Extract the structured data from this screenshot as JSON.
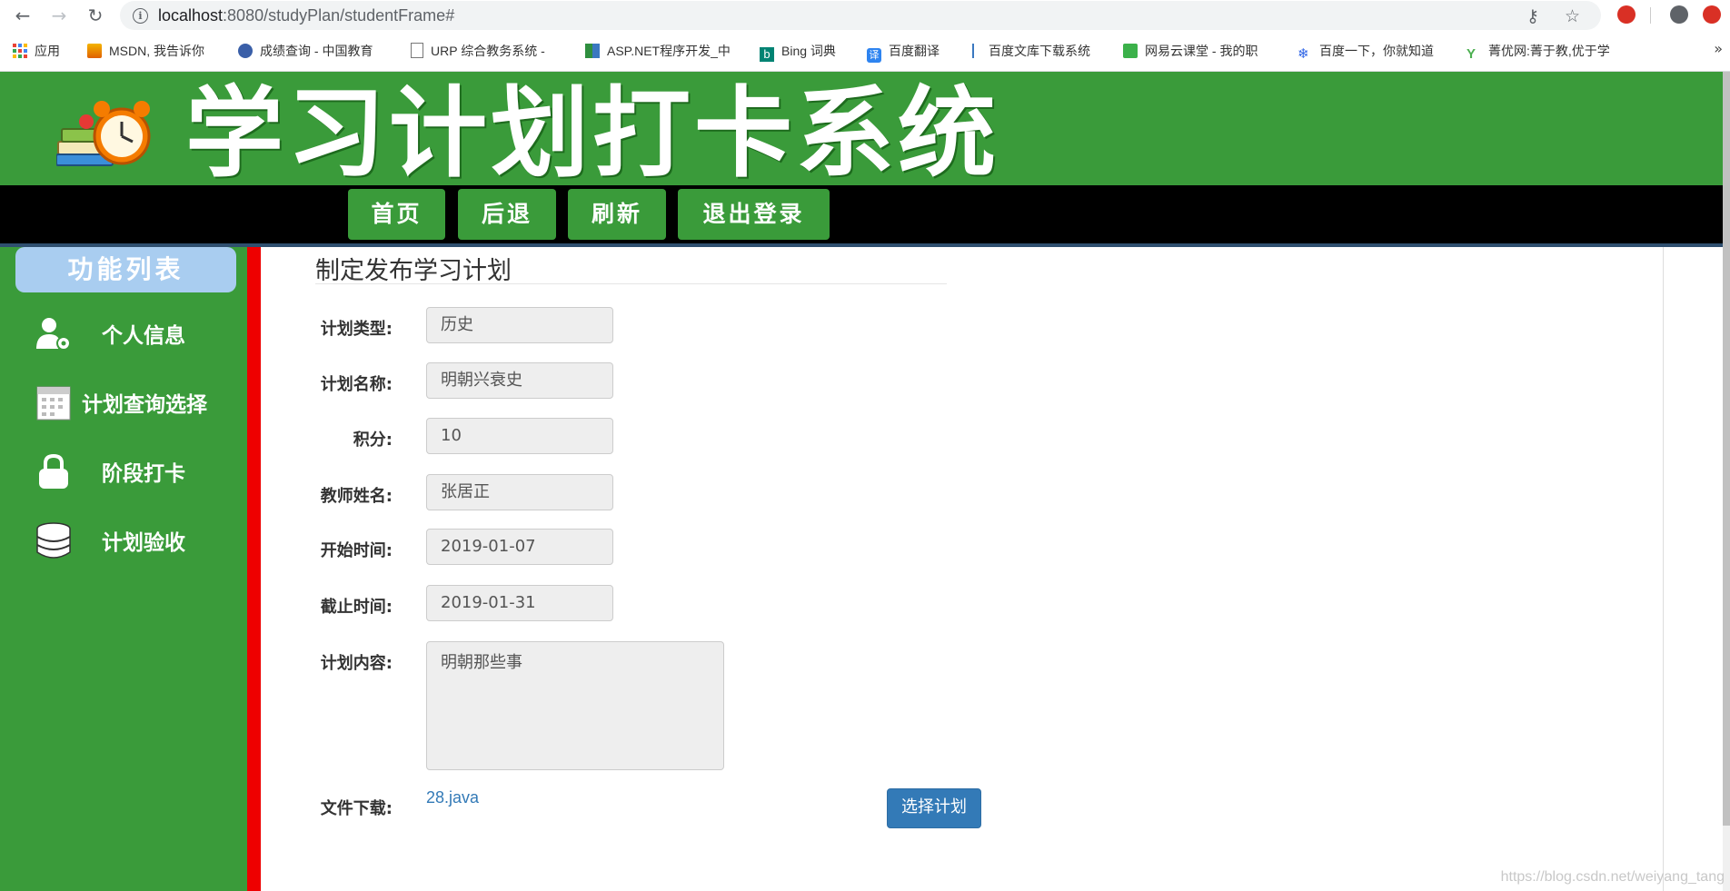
{
  "browser": {
    "url_host": "localhost",
    "url_rest": ":8080/studyPlan/studentFrame#",
    "bookmarks": [
      {
        "label": "应用",
        "icon": "apps-grid-icon"
      },
      {
        "label": "MSDN, 我告诉你",
        "icon": "msdn-icon"
      },
      {
        "label": "成绩查询 - 中国教育",
        "icon": "edu-globe-icon"
      },
      {
        "label": "URP 综合教务系统 -",
        "icon": "page-icon"
      },
      {
        "label": "ASP.NET程序开发_中",
        "icon": "book-icon"
      },
      {
        "label": "Bing 词典",
        "icon": "bing-icon"
      },
      {
        "label": "百度翻译",
        "icon": "translate-icon"
      },
      {
        "label": "百度文库下载系统",
        "icon": "flag-icon"
      },
      {
        "label": "网易云课堂 - 我的职",
        "icon": "netease-icon"
      },
      {
        "label": "百度一下，你就知道",
        "icon": "baidu-paw-icon"
      },
      {
        "label": "菁优网:菁于教,优于学",
        "icon": "jyeoo-icon"
      }
    ],
    "bookmarks_more": "»"
  },
  "header": {
    "title": "学习计划打卡系统"
  },
  "menu": {
    "home": "首页",
    "back": "后退",
    "refresh": "刷新",
    "logout": "退出登录"
  },
  "sidebar": {
    "title": "功能列表",
    "items": [
      {
        "label": "个人信息",
        "icon": "user-settings-icon"
      },
      {
        "label": "计划查询选择",
        "icon": "calendar-icon"
      },
      {
        "label": "阶段打卡",
        "icon": "lock-icon"
      },
      {
        "label": "计划验收",
        "icon": "database-icon"
      }
    ]
  },
  "form": {
    "heading": "制定发布学习计划",
    "plan_type_label": "计划类型:",
    "plan_type_value": "历史",
    "plan_name_label": "计划名称:",
    "plan_name_value": "明朝兴衰史",
    "points_label": "积分:",
    "points_value": "10",
    "teacher_label": "教师姓名:",
    "teacher_value": "张居正",
    "start_label": "开始时间:",
    "start_value": "2019-01-07",
    "end_label": "截止时间:",
    "end_value": "2019-01-31",
    "content_label": "计划内容:",
    "content_value": "明朝那些事",
    "file_label": "文件下载:",
    "file_link": "28.java",
    "select_button": "选择计划"
  },
  "watermark": "https://blog.csdn.net/weiyang_tang",
  "colors": {
    "header_green": "#3a9b3a",
    "divider_red": "#ee0000",
    "primary_blue": "#337ab7",
    "sidebar_title_blue": "#a9cdf0"
  }
}
